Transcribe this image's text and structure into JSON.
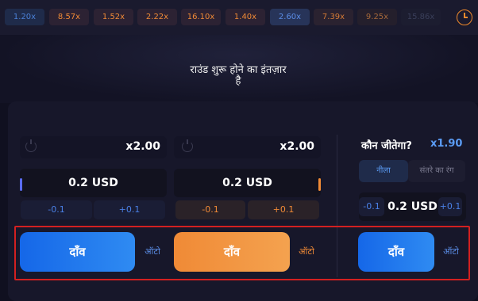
{
  "history": {
    "chips": [
      {
        "value": "1.20x",
        "color": "#4a80d6",
        "bg": "#1f2b4a"
      },
      {
        "value": "8.57x",
        "color": "#f08a36",
        "bg": "#2c2233"
      },
      {
        "value": "1.52x",
        "color": "#f08a36",
        "bg": "#2c2233"
      },
      {
        "value": "2.22x",
        "color": "#f08a36",
        "bg": "#2c2233"
      },
      {
        "value": "16.10x",
        "color": "#f08a36",
        "bg": "#2c2233"
      },
      {
        "value": "1.40x",
        "color": "#f08a36",
        "bg": "#2c2233"
      },
      {
        "value": "2.60x",
        "color": "#5b8de6",
        "bg": "#273459"
      },
      {
        "value": "7.39x",
        "color": "#d47a35",
        "bg": "#2a2230"
      },
      {
        "value": "9.25x",
        "color": "#a5683a",
        "bg": "#241f2c"
      },
      {
        "value": "15.86x",
        "color": "#3a3f5a",
        "bg": "#1c1d30"
      }
    ],
    "clock_icon": "clock-icon"
  },
  "game": {
    "waiting_line1": "राउंड शुरू होने का इंतज़ार",
    "waiting_line2": "है"
  },
  "left_bet": {
    "multiplier": "x2.00",
    "amount": "0.2 USD",
    "minus": "-0.1",
    "plus": "+0.1",
    "bet_label": "दाँव",
    "auto_label": "ऑटो",
    "accent": "#5a6cf0"
  },
  "mid_bet": {
    "multiplier": "x2.00",
    "amount": "0.2 USD",
    "minus": "-0.1",
    "plus": "+0.1",
    "bet_label": "दाँव",
    "auto_label": "ऑटो",
    "accent": "#f08a36"
  },
  "who_wins": {
    "title": "कौन जीतेगा?",
    "odds": "x1.90",
    "tab_blue": "नीला",
    "tab_orange": "संतरे का रंग",
    "amount": "0.2 USD",
    "minus": "-0.1",
    "plus": "+0.1",
    "bet_label": "दाँव",
    "auto_label": "ऑटो"
  }
}
